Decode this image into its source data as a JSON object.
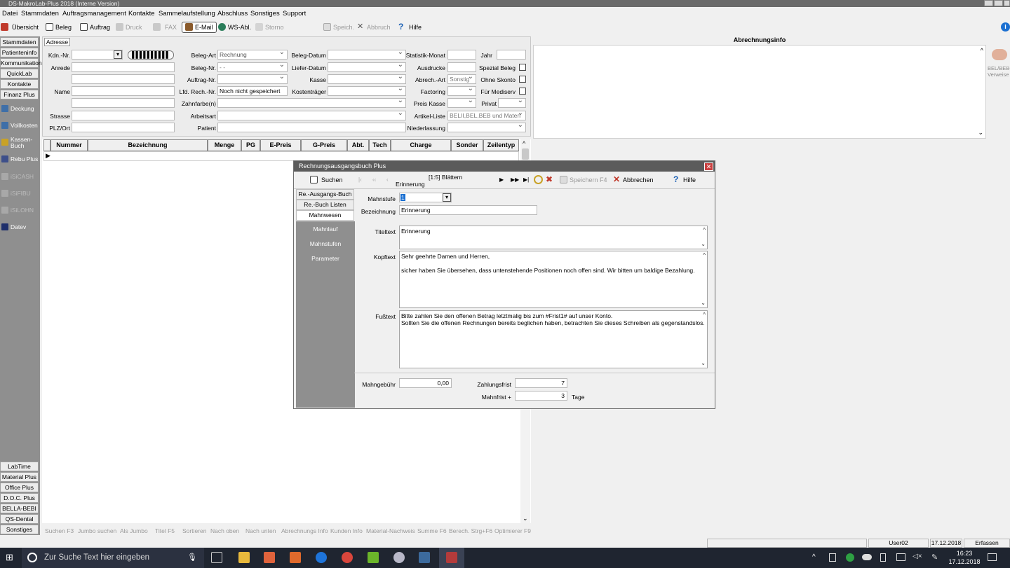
{
  "window": {
    "title": "DS-MakroLab-Plus 2018 (Interne Version)"
  },
  "menu": [
    "Datei",
    "Stammdaten",
    "Auftragsmanagement",
    "Kontakte",
    "Sammelaufstellung",
    "Abschluss",
    "Sonstiges",
    "Support"
  ],
  "toolbar": {
    "uebersicht": "Übersicht",
    "beleg": "Beleg",
    "auftrag": "Auftrag",
    "druck": "Druck",
    "fax": "FAX",
    "email": "E-Mail",
    "wsabl": "WS-Abl.",
    "storno": "Storno",
    "speich": "Speich.",
    "abbruch": "Abbruch",
    "hilfe": "Hilfe"
  },
  "nav": {
    "top": [
      "Stammdaten",
      "Patienteninfo",
      "Kommunikation",
      "QuickLab",
      "Kontakte",
      "Finanz Plus"
    ],
    "dark": [
      "Deckung",
      "Vollkosten",
      "Kassen-\nBuch",
      "Rebu Plus",
      "iSiCASH",
      "iSiFIBU",
      "iSiLOHN",
      "Datev"
    ],
    "bottom": [
      "LabTime",
      "Material Plus",
      "Office Plus",
      "D.O.C. Plus",
      "BELLA-BEBI",
      "QS-Dental",
      "Sonstiges"
    ]
  },
  "address": {
    "tab": "Adresse",
    "labels": {
      "kdn": "Kdn.-Nr.",
      "anrede": "Anrede",
      "name": "Name",
      "strasse": "Strasse",
      "plz": "PLZ/Ort",
      "belegart": "Beleg-Art",
      "belegnr": "Beleg-Nr.",
      "auftragnr": "Auftrag-Nr.",
      "lfdrech": "Lfd. Rech.-Nr.",
      "zahnfarbe": "Zahnfarbe(n)",
      "arbeitsart": "Arbeitsart",
      "patient": "Patient",
      "belegdatum": "Beleg-Datum",
      "lieferdatum": "Liefer-Datum",
      "kasse": "Kasse",
      "kostentraeger": "Kostenträger",
      "statistik": "Statistik-Monat",
      "ausdrucke": "Ausdrucke",
      "abrechart": "Abrech.-Art",
      "factoring": "Factoring",
      "preiskasse": "Preis Kasse",
      "artikelliste": "Artikel-Liste",
      "niederlassung": "Niederlassung",
      "jahr": "Jahr",
      "spezial": "Spezial Beleg",
      "ohneskonto": "Ohne Skonto",
      "fuermediserv": "Für Mediserv",
      "privat": "Privat"
    },
    "values": {
      "belegart": "Rechnung",
      "belegnr": "- -",
      "lfdrech": "Noch nicht gespeichert",
      "abrechart": "Sonstig",
      "artikelliste": "BELII,BEL,BEB und Materi"
    }
  },
  "abrechnungsinfo": {
    "title": "Abrechnungsinfo",
    "side": "BEL/BEB-\nVerweise"
  },
  "grid": {
    "columns": [
      "Nummer",
      "Bezeichnung",
      "Menge",
      "PG",
      "E-Preis",
      "G-Preis",
      "Abt.",
      "Tech",
      "Charge",
      "Sonder",
      "Zeilentyp"
    ]
  },
  "dialog": {
    "title": "Rechnungsausgangsbuch Plus",
    "toolbar": {
      "suchen": "Suchen",
      "blaettern": "[1:5] Blättern",
      "erinnerung": "Erinnerung",
      "speichern": "Speichern F4",
      "abbrechen": "Abbrechen",
      "hilfe": "Hilfe"
    },
    "nav": [
      "Re.-Ausgangs-Buch",
      "Re.-Buch Listen",
      "Mahnwesen"
    ],
    "side": [
      "Mahnlauf",
      "Mahnstufen",
      "Parameter"
    ],
    "labels": {
      "mahnstufe": "Mahnstufe",
      "bezeichnung": "Bezeichnung",
      "titeltext": "Titeltext",
      "kopftext": "Kopftext",
      "fusstext": "Fußtext",
      "mahngebuehr": "Mahngebühr",
      "zahlungsfrist": "Zahlungsfrist",
      "mahnfrist": "Mahnfrist +",
      "tage": "Tage"
    },
    "values": {
      "mahnstufe": "1",
      "bezeichnung": "Erinnerung",
      "titeltext": "Erinnerung",
      "kopftext": "Sehr geehrte Damen und Herren,\n\nsicher haben Sie übersehen, dass untenstehende Positionen noch offen sind. Wir bitten um baldige Bezahlung.",
      "fusstext": "Bitte zahlen Sie den offenen Betrag letztmalig bis zum #Frist1# auf unser Konto.\nSollten Sie die offenen Rechnungen bereits beglichen haben, betrachten Sie dieses Schreiben als gegenstandslos.",
      "mahngebuehr": "0,00",
      "zahlungsfrist": "7",
      "mahnfrist": "3"
    }
  },
  "bottom_actions": [
    "Suchen F3",
    "Jumbo suchen",
    "Als Jumbo",
    "Titel F5",
    "Sortieren",
    "Nach oben",
    "Nach unten",
    "Abrechnungs Info",
    "Kunden Info",
    "Material-Nachweis",
    "Summe F6",
    "Berech. Strg+F6",
    "Optimierer F9"
  ],
  "status": {
    "user": "User02",
    "date": "17.12.2018",
    "mode": "Erfassen"
  },
  "taskbar": {
    "search_placeholder": "Zur Suche Text hier eingeben",
    "time": "16:23",
    "date": "17.12.2018"
  }
}
